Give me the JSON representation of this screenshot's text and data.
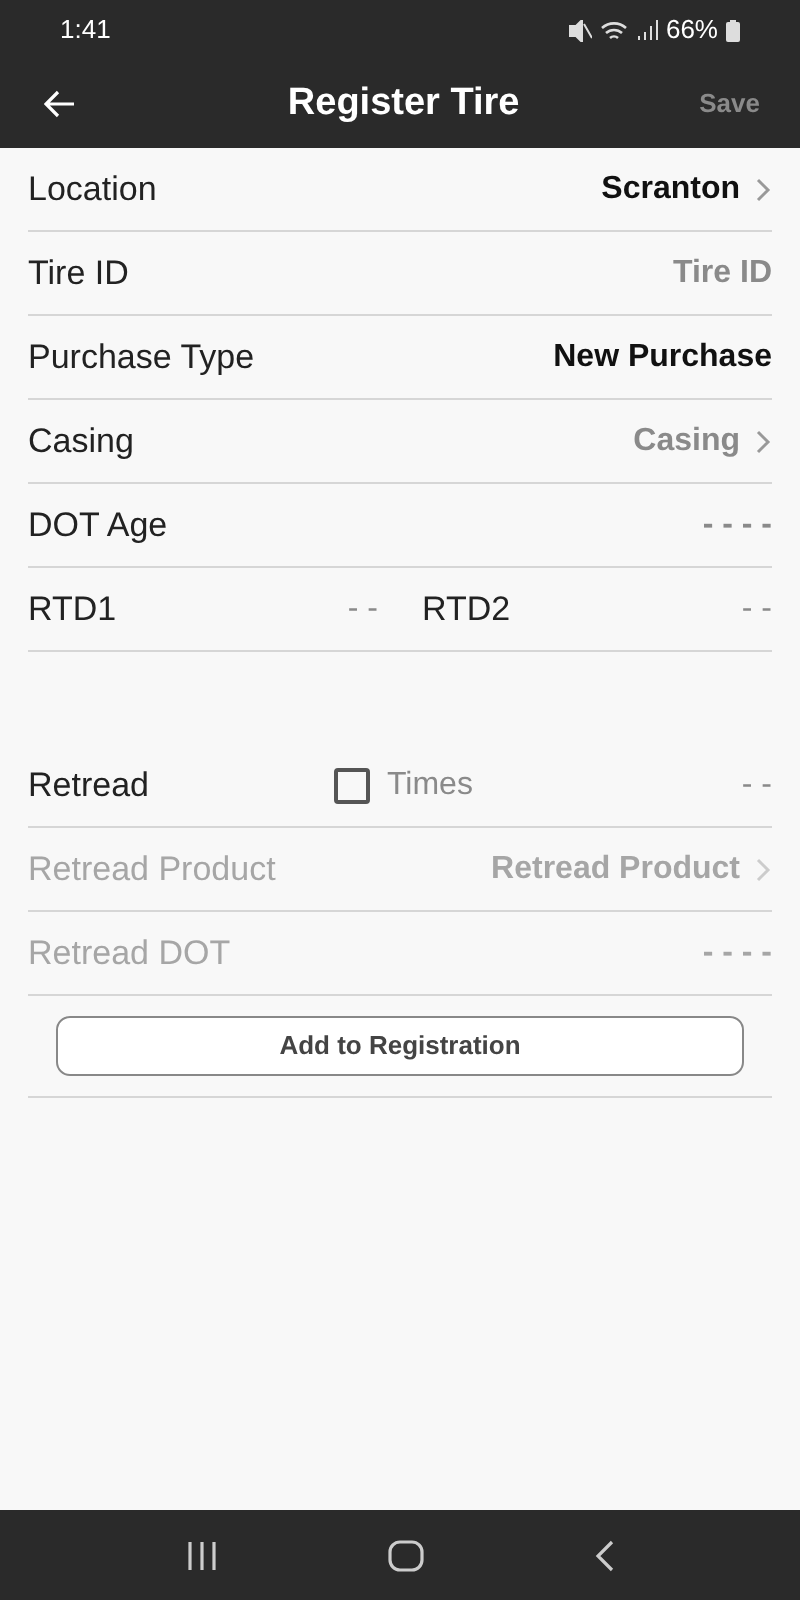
{
  "status_bar": {
    "time": "1:41",
    "battery": "66%"
  },
  "header": {
    "title": "Register Tire",
    "save": {
      "label": "Save",
      "disabled": true
    }
  },
  "tire_fields": [
    {
      "kind": "select",
      "label": "Location",
      "value": "Scranton",
      "disabled": false
    },
    {
      "kind": "input",
      "label": "Tire ID",
      "placeholder": "Tire ID",
      "disabled": false
    },
    {
      "kind": "text",
      "label": "Purchase Type",
      "value": "New Purchase",
      "disabled": false
    },
    {
      "kind": "select",
      "label": "Casing",
      "placeholder": "Casing",
      "disabled": false
    },
    {
      "kind": "input",
      "label": "DOT Age",
      "placeholder": "- - - -",
      "disabled": false
    },
    {
      "kind": "pair",
      "items": [
        {
          "label": "RTD1",
          "placeholder": "- -"
        },
        {
          "label": "RTD2",
          "placeholder": "- -"
        }
      ],
      "disabled": false
    }
  ],
  "retread_fields": [
    {
      "kind": "check",
      "label": "Retread",
      "checked": false,
      "sub_placeholder": "Times",
      "placeholder": "- -",
      "disabled": false
    },
    {
      "kind": "select",
      "label": "Retread Product",
      "placeholder": "Retread Product",
      "disabled": true
    },
    {
      "kind": "input",
      "label": "Retread DOT",
      "placeholder": "- - - -",
      "disabled": true
    }
  ],
  "add_button": "Add to Registration"
}
